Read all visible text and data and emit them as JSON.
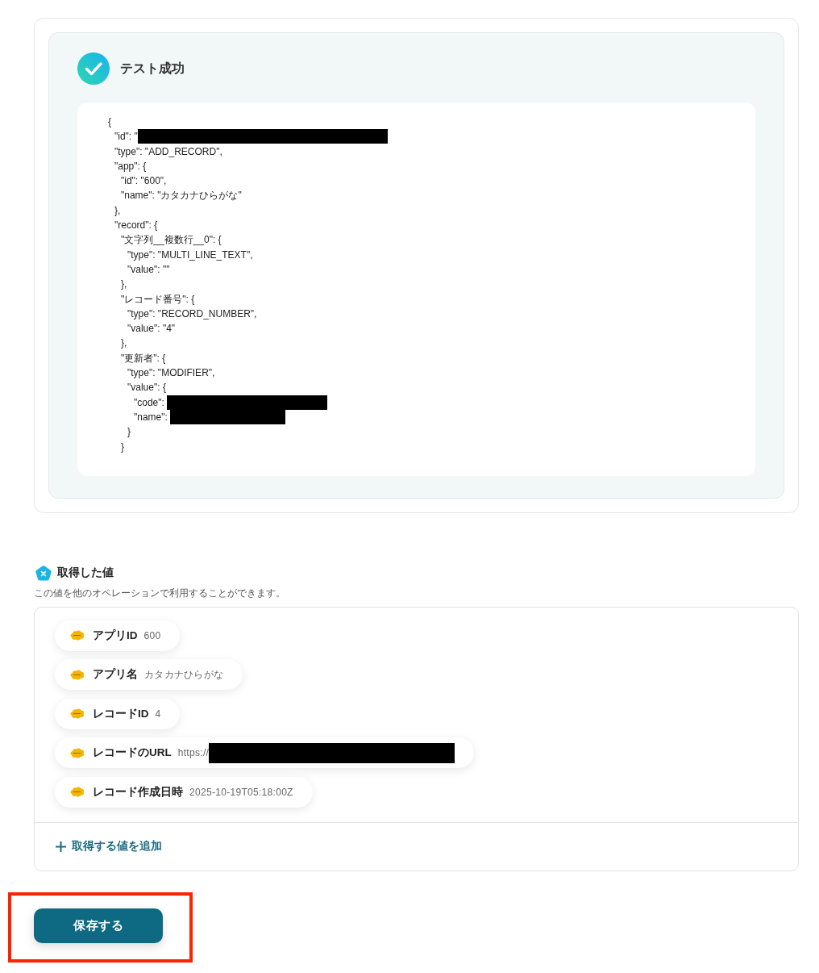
{
  "test_result": {
    "success": true,
    "title": "テスト成功",
    "code_lines": [
      {
        "text": "{",
        "children": [
          {
            "text": "\"id\": \"",
            "redacted": true
          },
          {
            "text": "\"type\": \"ADD_RECORD\","
          },
          {
            "text": "\"app\": {",
            "children": [
              {
                "text": "\"id\": \"600\","
              },
              {
                "text": "\"name\": \"カタカナひらがな\""
              }
            ]
          },
          {
            "text": "},"
          },
          {
            "text": "\"record\": {",
            "children": [
              {
                "text": "\"文字列__複数行__0\": {",
                "children": [
                  {
                    "text": "\"type\": \"MULTI_LINE_TEXT\","
                  },
                  {
                    "text": "\"value\": \"\""
                  }
                ]
              },
              {
                "text": "},"
              },
              {
                "text": "\"レコード番号\": {",
                "children": [
                  {
                    "text": "\"type\": \"RECORD_NUMBER\","
                  },
                  {
                    "text": "\"value\": \"4\""
                  }
                ]
              },
              {
                "text": "},"
              },
              {
                "text": "\"更新者\": {",
                "children": [
                  {
                    "text": "\"type\": \"MODIFIER\","
                  },
                  {
                    "text": "\"value\": {",
                    "children": [
                      {
                        "text": "\"code\": ",
                        "redacted": true
                      },
                      {
                        "text": "\"name\": ",
                        "redacted": true
                      }
                    ]
                  },
                  {
                    "text": "}"
                  }
                ]
              },
              {
                "text": "}"
              }
            ]
          }
        ]
      }
    ]
  },
  "acquired_values": {
    "title": "取得した値",
    "description": "この値を他のオペレーションで利用することができます。",
    "items": [
      {
        "label": "アプリID",
        "value": "600"
      },
      {
        "label": "アプリ名",
        "value": "カタカナひらがな"
      },
      {
        "label": "レコードID",
        "value": "4"
      },
      {
        "label": "レコードのURL",
        "value": "https://",
        "redacted": true
      },
      {
        "label": "レコード作成日時",
        "value": "2025-10-19T05:18:00Z"
      }
    ],
    "add_link": "取得する値を追加"
  },
  "save_button": {
    "label": "保存する",
    "highlighted": true
  }
}
